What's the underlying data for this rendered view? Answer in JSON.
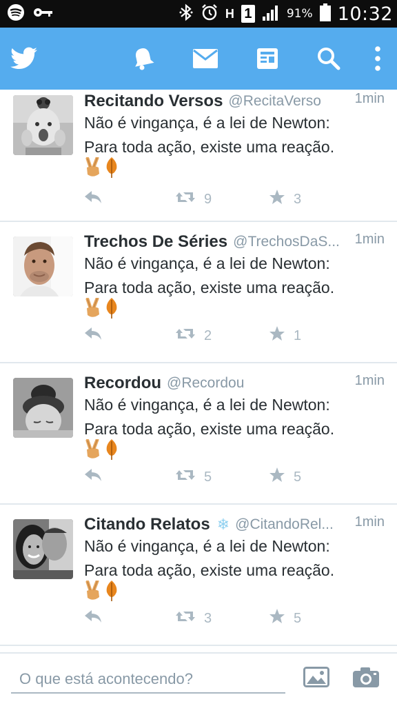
{
  "status_bar": {
    "network_indicator": "H",
    "sim_slot": "1",
    "battery_percent": "91%",
    "time": "10:32"
  },
  "toolbar": {
    "icons": [
      "twitter-bird-icon",
      "notifications-bell-icon",
      "messages-envelope-icon",
      "news-icon",
      "search-icon",
      "more-vert-icon"
    ],
    "background_color": "#55acee"
  },
  "tweets": [
    {
      "name": "Recitando Versos",
      "handle": "@RecitaVerso",
      "time": "1min",
      "line1": "Não é vingança, é a lei de Newton:",
      "line2": "Para toda ação, existe uma reação.",
      "retweets": "9",
      "favorites": "3",
      "verified_badge": false
    },
    {
      "name": "Trechos De Séries",
      "handle": "@TrechosDaS...",
      "time": "1min",
      "line1": "Não é vingança, é a lei de Newton:",
      "line2": "Para toda ação, existe uma reação.",
      "retweets": "2",
      "favorites": "1",
      "verified_badge": false
    },
    {
      "name": "Recordou",
      "handle": "@Recordou",
      "time": "1min",
      "line1": "Não é vingança, é a lei de Newton:",
      "line2": "Para toda ação, existe uma reação.",
      "retweets": "5",
      "favorites": "5",
      "verified_badge": false
    },
    {
      "name": "Citando Relatos",
      "handle": "@CitandoRel...",
      "time": "1min",
      "line1": "Não é vingança, é a lei de Newton:",
      "line2": "Para toda ação, existe uma reação.",
      "retweets": "3",
      "favorites": "5",
      "verified_badge": true
    }
  ],
  "compose": {
    "placeholder": "O que está acontecendo?"
  },
  "colors": {
    "accent": "#55acee",
    "muted_text": "#8899a6",
    "action_icons": "#aab8c2"
  }
}
